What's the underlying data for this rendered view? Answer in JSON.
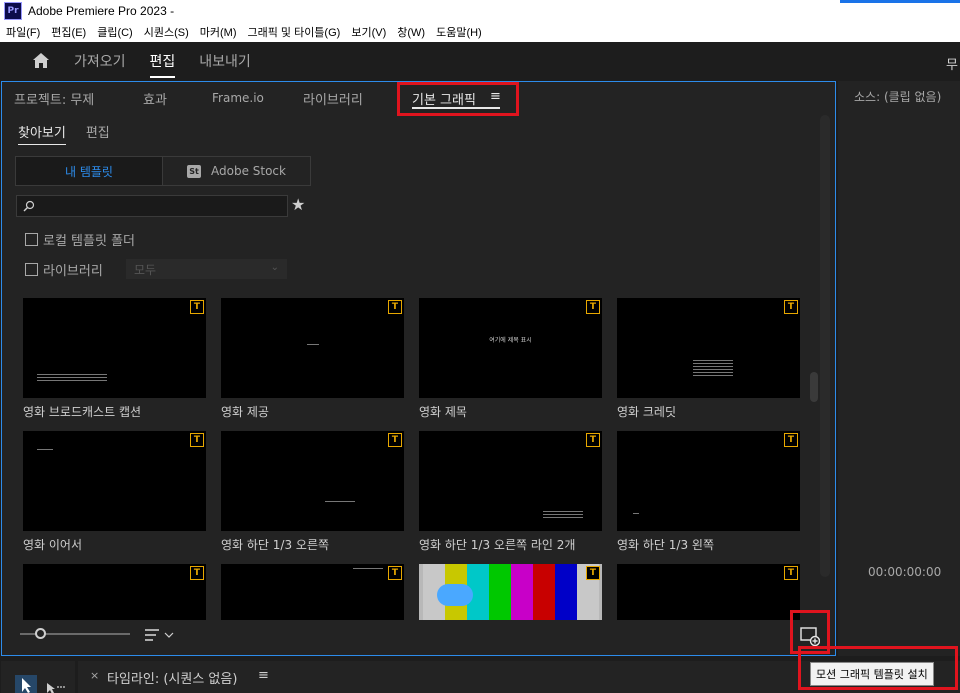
{
  "window": {
    "logo": "Pr",
    "title": "Adobe Premiere Pro 2023 -"
  },
  "menu": [
    "파일(F)",
    "편집(E)",
    "클립(C)",
    "시퀀스(S)",
    "마커(M)",
    "그래픽 및 타이틀(G)",
    "보기(V)",
    "창(W)",
    "도움말(H)"
  ],
  "workspace": {
    "tabs": [
      "가져오기",
      "편집",
      "내보내기"
    ],
    "active": "편집",
    "right_glyph": "무"
  },
  "panel": {
    "tabs": [
      "프로젝트: 무제",
      "효과",
      "Frame.io",
      "라이브러리",
      "기본 그래픽"
    ],
    "active_tab": "기본 그래픽",
    "tab_menu": "≡",
    "subtabs": [
      "찾아보기",
      "편집"
    ],
    "source_mine": "내 템플릿",
    "source_stock_badge": "St",
    "source_stock": "Adobe Stock",
    "search_placeholder": "",
    "star": "★",
    "local_folder_label": "로컬 템플릿 폴더",
    "library_label": "라이브러리",
    "library_value": "모두",
    "library_chevron": "⌄",
    "badge_letter": "T"
  },
  "templates": [
    {
      "label": "영화 브로드캐스트 캡션",
      "preview": "broadcast"
    },
    {
      "label": "영화 제공",
      "preview": "present"
    },
    {
      "label": "영화 제목",
      "preview": "title",
      "overlay": "여기에 제목 표시"
    },
    {
      "label": "영화 크레딧",
      "preview": "credits"
    },
    {
      "label": "영화 이어서",
      "preview": "continue"
    },
    {
      "label": "영화 하단 1/3 오른쪽",
      "preview": "lower-right"
    },
    {
      "label": "영화 하단 1/3 오른쪽 라인 2개",
      "preview": "lower-right-2"
    },
    {
      "label": "영화 하단 1/3 왼쪽",
      "preview": "lower-left"
    },
    {
      "label": "",
      "preview": "blank"
    },
    {
      "label": "",
      "preview": "timecode"
    },
    {
      "label": "",
      "preview": "bars"
    },
    {
      "label": "",
      "preview": "blank"
    }
  ],
  "right_panel": {
    "title": "소스: (클립 없음)",
    "timecode": "00:00:00:00"
  },
  "timeline": {
    "close": "×",
    "title": "타임라인: (시퀀스 없음)",
    "menu": "≡"
  },
  "tooltip": "모션 그래픽 템플릿 설치",
  "colors": {
    "accent": "#2d8ceb",
    "highlight": "#e0141e",
    "badge": "#e8a800"
  }
}
